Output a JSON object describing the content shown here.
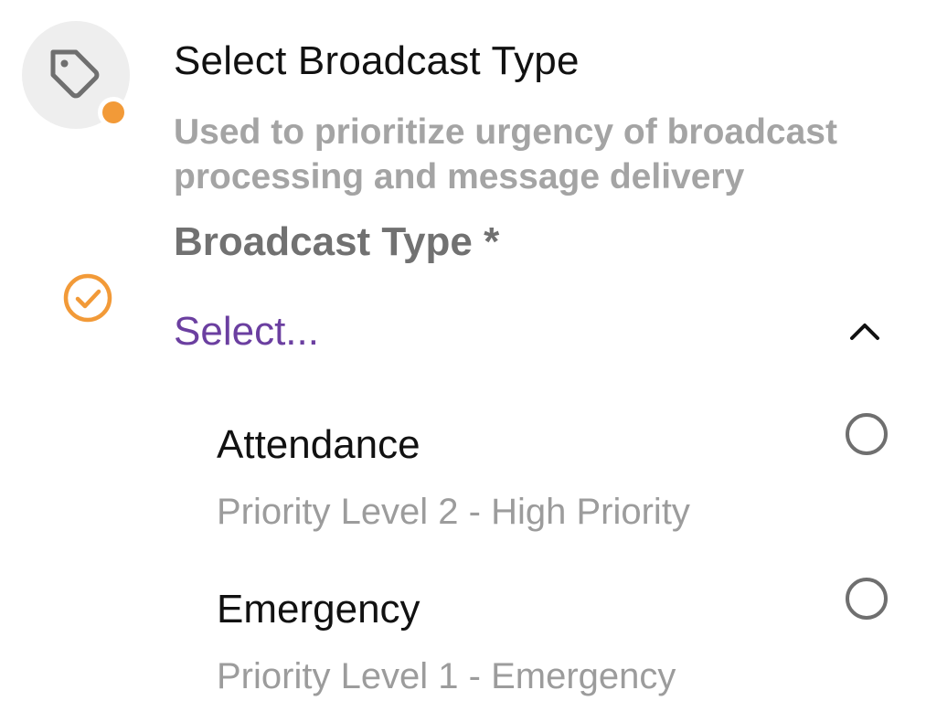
{
  "step": {
    "title": "Select Broadcast Type",
    "description": "Used to prioritize urgency of broadcast processing and message delivery",
    "icon": "tag-icon",
    "status_color": "#f29a38"
  },
  "field": {
    "label": "Broadcast Type *",
    "placeholder": "Select...",
    "expanded": true,
    "check_icon": "check-circle-icon",
    "accent_color": "#6b3fa0"
  },
  "options": [
    {
      "title": "Attendance",
      "subtitle": "Priority Level 2 - High Priority",
      "selected": false
    },
    {
      "title": "Emergency",
      "subtitle": "Priority Level 1 - Emergency",
      "selected": false
    }
  ]
}
